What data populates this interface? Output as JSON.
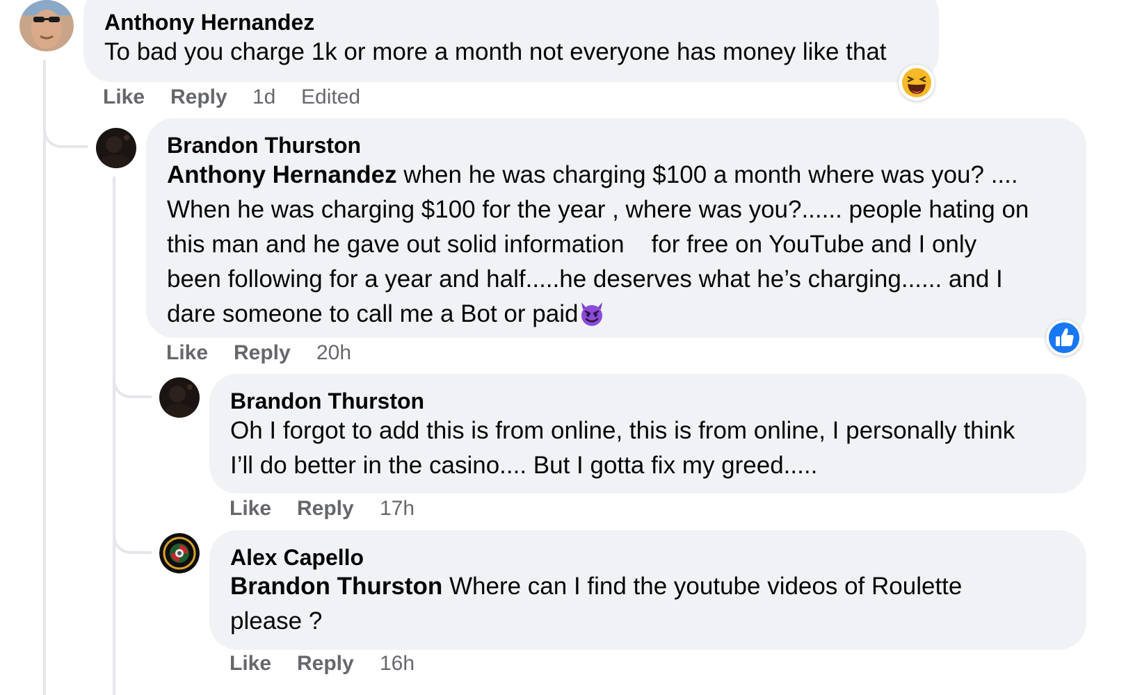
{
  "comments": [
    {
      "author": "Anthony Hernandez",
      "mention": "",
      "text": "To bad you charge 1k or more a month not everyone has money like that",
      "like_label": "Like",
      "reply_label": "Reply",
      "time": "1d",
      "edited": "Edited",
      "reaction": "laughing-emoji",
      "avatar": "man-with-sunglasses-photo"
    },
    {
      "author": "Brandon Thurston",
      "mention": "Anthony Hernandez",
      "text_lines": [
        " when he was charging $100 a month where was you? ....",
        "When he was charging $100 for the year , where was you?...... people hating on",
        "this man and he gave out solid information    for free on YouTube and I only",
        "been following for a year and half.....he deserves what he’s charging...... and I",
        "dare someone to call me a Bot or paid"
      ],
      "trailing_emoji": "smiling-face-with-horns",
      "like_label": "Like",
      "reply_label": "Reply",
      "time": "20h",
      "reaction": "like-thumbs-up",
      "avatar": "dark-profile-photo"
    },
    {
      "author": "Brandon Thurston",
      "text_lines": [
        "Oh I forgot to add this is from online, this is from online, I personally think",
        "I’ll do better in the casino.... But I gotta fix my greed....."
      ],
      "like_label": "Like",
      "reply_label": "Reply",
      "time": "17h",
      "avatar": "dark-profile-photo"
    },
    {
      "author": "Alex Capello",
      "mention": "Brandon Thurston",
      "text_lines": [
        " Where can I find the youtube videos of Roulette",
        "please ?"
      ],
      "like_label": "Like",
      "reply_label": "Reply",
      "time": "16h",
      "avatar": "circular-logo"
    }
  ],
  "colors": {
    "bubble": "#f0f2f5",
    "meta_text": "#65676b",
    "thread_line": "#e4e6eb",
    "like_blue": "#1877f2"
  }
}
